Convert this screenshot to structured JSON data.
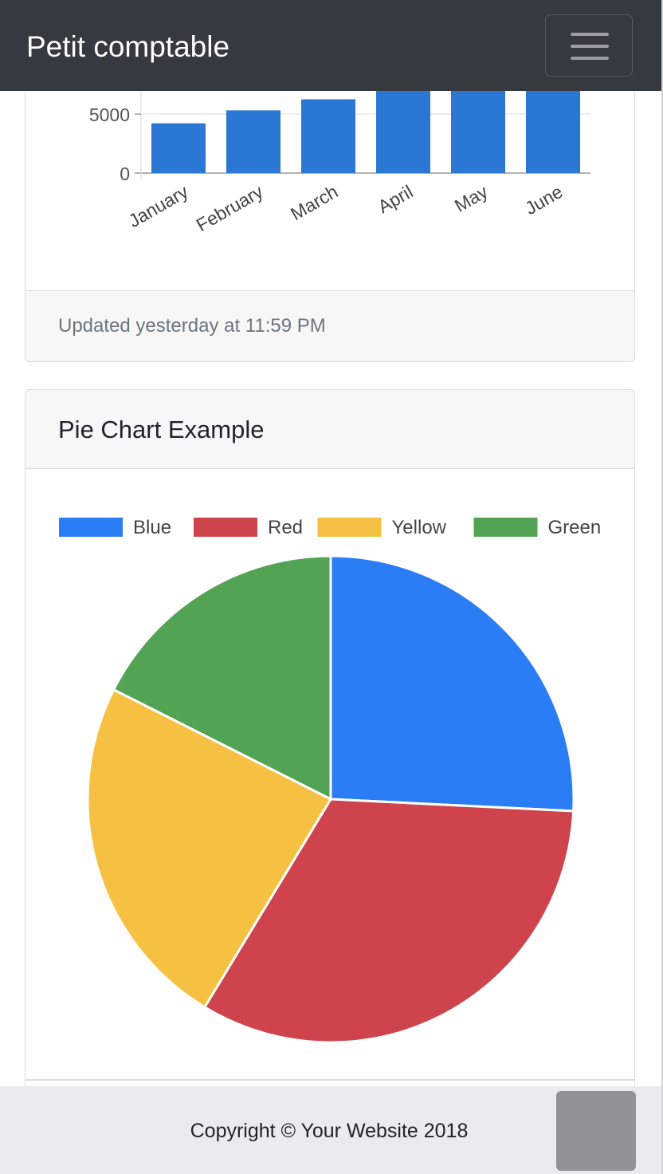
{
  "navbar": {
    "brand": "Petit comptable",
    "toggle_icon": "hamburger-icon"
  },
  "bar_card": {
    "footer_text": "Updated yesterday at 11:59 PM"
  },
  "pie_card": {
    "title": "Pie Chart Example"
  },
  "footer": {
    "copyright": "Copyright © Your Website 2018",
    "scroll_top_icon": "scroll-to-top-button"
  },
  "chart_data": [
    {
      "type": "bar",
      "title": "",
      "categories": [
        "January",
        "February",
        "March",
        "April",
        "May",
        "June"
      ],
      "values": [
        4215,
        5312,
        6251,
        7841,
        9821,
        14984
      ],
      "color": "#2b77d4",
      "ylim": [
        0,
        15000
      ],
      "yticks": [
        0,
        5000
      ],
      "grid": true,
      "note": ""
    },
    {
      "type": "pie",
      "labels": [
        "Blue",
        "Red",
        "Yellow",
        "Green"
      ],
      "values": [
        12.21,
        15.58,
        11.25,
        8.32
      ],
      "colors": [
        "#2a7df4",
        "#cf444c",
        "#f6c143",
        "#52a454"
      ],
      "legend": "top"
    }
  ]
}
